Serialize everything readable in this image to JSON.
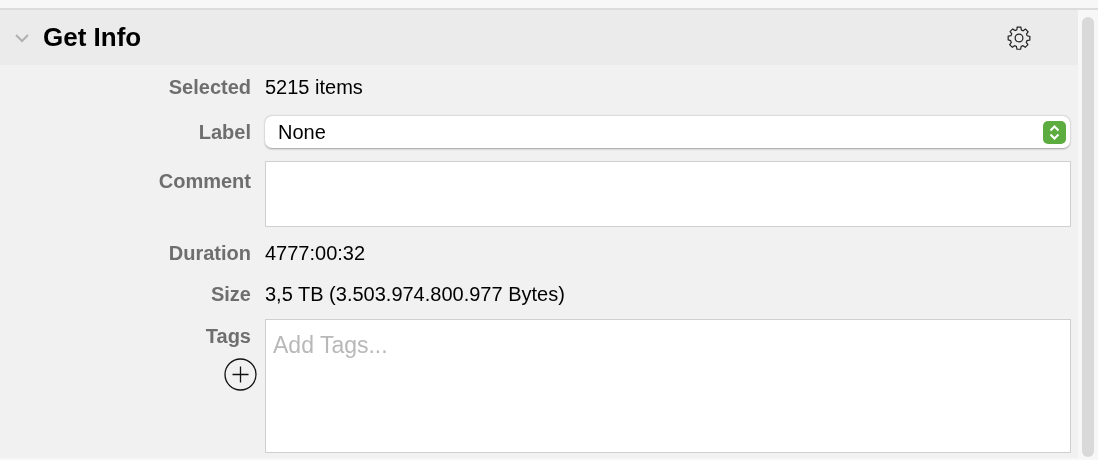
{
  "section": {
    "title": "Get Info",
    "expanded": true
  },
  "rows": [
    {
      "kind": "text",
      "label": "Selected",
      "value": "5215 items"
    },
    {
      "kind": "popup",
      "label": "Label",
      "value": "None"
    },
    {
      "kind": "textarea",
      "label": "Comment"
    },
    {
      "kind": "text",
      "label": "Duration",
      "value": "4777:00:32"
    },
    {
      "kind": "text",
      "label": "Size",
      "value": "3,5 TB (3.503.974.800.977 Bytes)"
    },
    {
      "kind": "tags",
      "label": "Tags",
      "placeholder": "Add Tags..."
    }
  ]
}
